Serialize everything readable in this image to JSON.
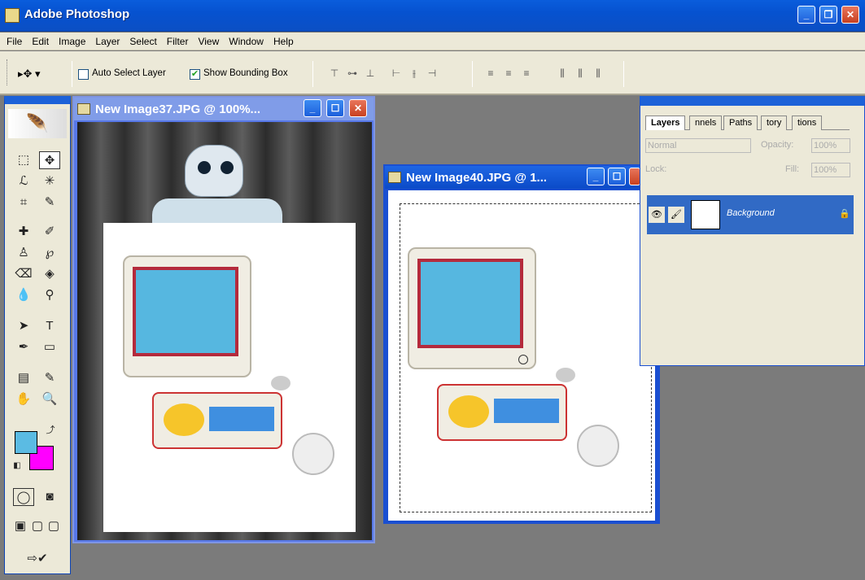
{
  "app": {
    "title": "Adobe Photoshop"
  },
  "menu": [
    "File",
    "Edit",
    "Image",
    "Layer",
    "Select",
    "Filter",
    "View",
    "Window",
    "Help"
  ],
  "options": {
    "auto_select_label": "Auto Select Layer",
    "auto_select_checked": false,
    "show_bbox_label": "Show Bounding Box",
    "show_bbox_checked": true
  },
  "documents": [
    {
      "title": "New Image37.JPG @ 100%..."
    },
    {
      "title": "New Image40.JPG @ 1..."
    }
  ],
  "layers_panel": {
    "tabs": [
      "Layers",
      "nnels",
      "Paths",
      "tory",
      "tions"
    ],
    "blend_mode": "Normal",
    "opacity_label": "Opacity:",
    "opacity_value": "100%",
    "lock_label": "Lock:",
    "fill_label": "Fill:",
    "fill_value": "100%",
    "layer_name": "Background"
  },
  "colors": {
    "foreground": "#5bbbe3",
    "background": "#ff00ff",
    "titlebar": "#0a5ddc"
  }
}
